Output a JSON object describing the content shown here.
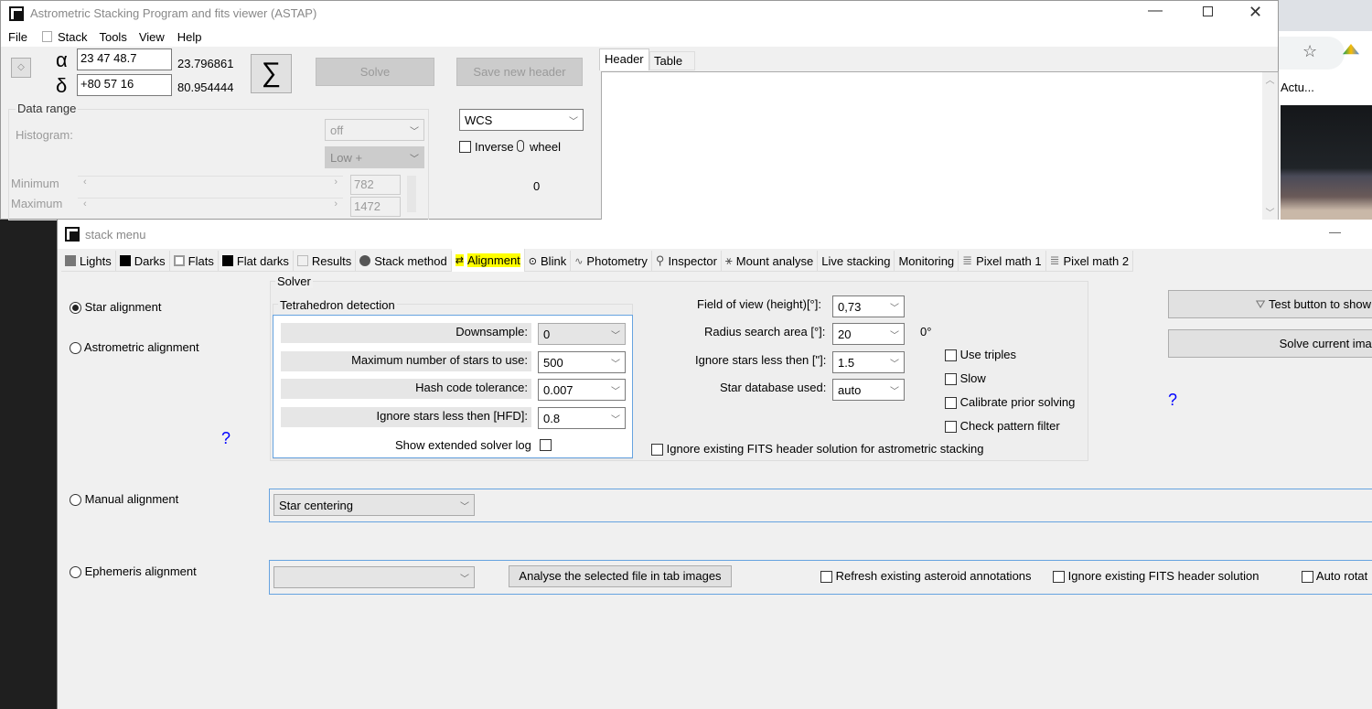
{
  "main_window": {
    "title": "Astrometric Stacking Program and fits viewer (ASTAP)",
    "menu": [
      "File",
      "Stack",
      "Tools",
      "View",
      "Help"
    ],
    "alpha_symbol": "α",
    "delta_symbol": "δ",
    "ra_input": "23 47 48.7",
    "dec_input": "+80 57 16",
    "ra_decimal": "23.796861",
    "dec_decimal": "80.954444",
    "sigma_label": "∑",
    "solve_label": "Solve",
    "save_header_label": "Save new header",
    "data_range_label": "Data range",
    "histogram_label": "Histogram:",
    "histogram_value": "off",
    "stretch_value": "Low +",
    "minimum_label": "Minimum",
    "maximum_label": "Maximum",
    "minimum_value": "782",
    "maximum_value": "1472",
    "wcs_value": "WCS",
    "inverse_label": "Inverse",
    "wheel_label": "wheel",
    "zero_value": "0",
    "tabs": [
      "Header",
      "Table"
    ]
  },
  "browser": {
    "partial_text": "Actu..."
  },
  "stack_window": {
    "title": "stack menu",
    "tabs": [
      "Lights",
      "Darks",
      "Flats",
      "Flat darks",
      "Results",
      "Stack method",
      "Alignment",
      "Blink",
      "Photometry",
      "Inspector",
      "Mount analyse",
      "Live stacking",
      "Monitoring",
      "Pixel math 1",
      "Pixel math 2"
    ],
    "active_tab": "Alignment",
    "highlight_color": "#ffff00",
    "alignment_options": [
      "Star alignment",
      "Astrometric alignment",
      "Manual alignment",
      "Ephemeris alignment"
    ],
    "selected_alignment": "Star alignment",
    "help_mark": "?",
    "solver": {
      "label": "Solver",
      "tetra_label": "Tetrahedron detection",
      "downsample_label": "Downsample:",
      "downsample_value": "0",
      "max_stars_label": "Maximum number of stars to use:",
      "max_stars_value": "500",
      "hash_label": "Hash code tolerance:",
      "hash_value": "0.007",
      "ignore_hfd_label": "Ignore stars less then [HFD]:",
      "ignore_hfd_value": "0.8",
      "ext_log_label": "Show extended solver log",
      "fov_label": "Field of view (height)[°]:",
      "fov_value": "0,73",
      "radius_label": "Radius search area  [°]:",
      "radius_value": "20",
      "radius_readout": "0°",
      "ignore_arcsec_label": "Ignore stars less then [\"]:",
      "ignore_arcsec_value": "1.5",
      "db_label": "Star database used:",
      "db_value": "auto",
      "use_triples": "Use triples",
      "slow": "Slow",
      "calibrate": "Calibrate prior solving",
      "check_pattern": "Check pattern filter",
      "ignore_fits": "Ignore existing FITS header solution for astrometric stacking"
    },
    "test_button": "Test button to show",
    "solve_current": "Solve current imag",
    "manual_value": "Star centering",
    "ephemeris": {
      "combo_value": "",
      "analyse_button": "Analyse the selected file in tab images",
      "refresh": "Refresh existing asteroid annotations",
      "ignore_fits": "Ignore existing FITS header solution",
      "auto_rotate": "Auto rotat"
    }
  }
}
